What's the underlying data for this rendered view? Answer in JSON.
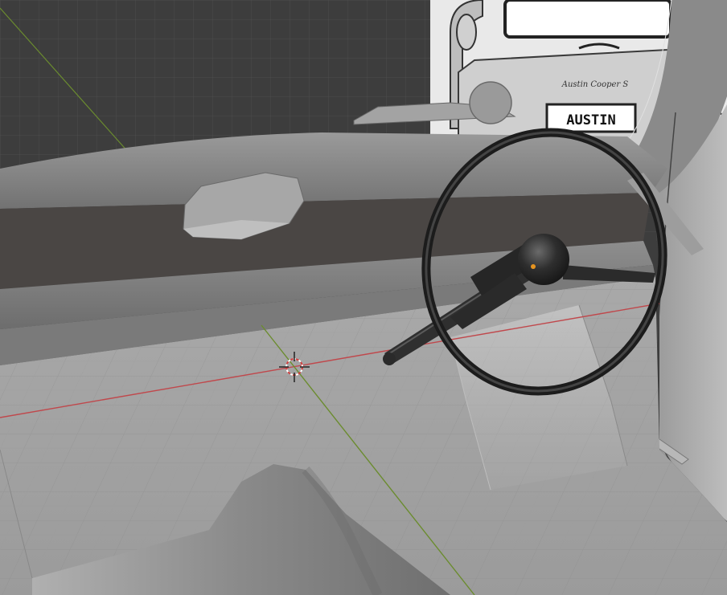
{
  "viewport": {
    "mode": "3D Viewport",
    "background_color": "#3d3d3d",
    "x_axis_color": "#c0484c",
    "y_axis_color": "#6b8c2f"
  },
  "reference_image": {
    "plate_text": "AUSTIN",
    "script_text": "Austin Cooper S"
  },
  "scene": {
    "objects": [
      "dashboard",
      "parcel-shelf",
      "steering-wheel",
      "steering-column",
      "floor-pan",
      "transmission-tunnel",
      "door-panel",
      "windscreen-frame"
    ],
    "cursor": "3d-cursor"
  }
}
